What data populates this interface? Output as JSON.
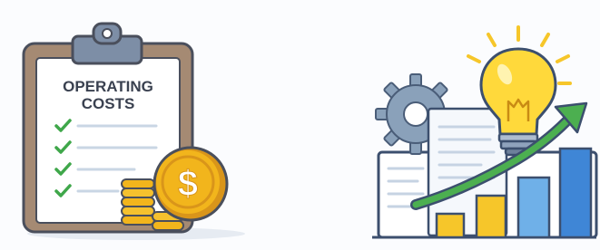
{
  "clipboard": {
    "title_line1": "OPERATING",
    "title_line2": "COSTS",
    "checklist_items": 4
  },
  "coin": {
    "symbol": "$"
  },
  "colors": {
    "clipboard_frame": "#a58a73",
    "clip": "#7d8ea6",
    "paper": "#ffffff",
    "check": "#3fa74a",
    "coin": "#f2b51c",
    "coin_dark": "#d9951a",
    "gear": "#8aa1ba",
    "bulb": "#ffd93b",
    "arrow": "#4caf50",
    "bar_yellow": "#f6c62a",
    "bar_blue": "#4a8fd8"
  },
  "icons": {
    "left": "operating-costs-clipboard-illustration",
    "right": "growth-lightbulb-chart-illustration"
  }
}
